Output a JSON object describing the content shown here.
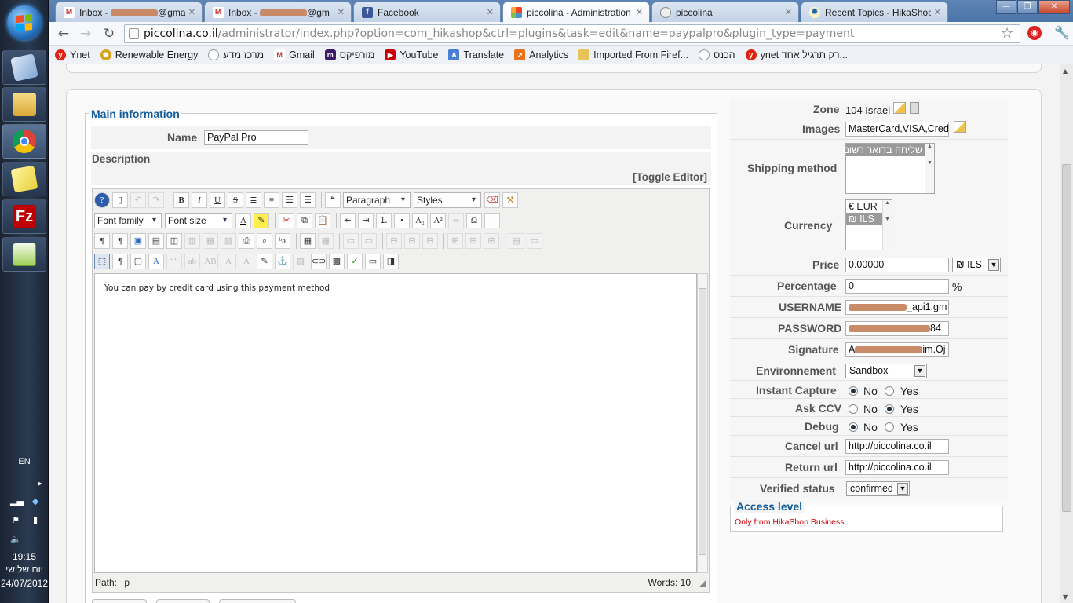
{
  "taskbar": {
    "lang": "EN",
    "time": "19:15",
    "day": "יום שלישי",
    "date": "24/07/2012"
  },
  "browser": {
    "tabs": [
      {
        "label": "Inbox - ",
        "suffix": "@gmai",
        "icon": "gmail-icon"
      },
      {
        "label": "Inbox - ",
        "suffix": "@gm",
        "icon": "gmail-icon"
      },
      {
        "label": "Facebook",
        "suffix": "",
        "icon": "facebook-icon"
      },
      {
        "label": "piccolina - Administration",
        "suffix": "",
        "icon": "joomla-icon"
      },
      {
        "label": "piccolina",
        "suffix": "",
        "icon": "globe-icon"
      },
      {
        "label": "Recent Topics - HikaShop",
        "suffix": "",
        "icon": "hikashop-icon"
      }
    ],
    "url_host": "piccolina.co.il",
    "url_path": "/administrator/index.php?option=com_hikashop&ctrl=plugins&task=edit&name=paypalpro&plugin_type=payment",
    "bookmarks": [
      "Ynet",
      "Renewable Energy",
      "מרכז מדע",
      "Gmail",
      "מורפיקס",
      "YouTube",
      "Translate",
      "Analytics",
      "Imported From Firef...",
      "הכנס",
      "ynet רק תרגיל אחד..."
    ]
  },
  "main": {
    "legend": "Main information",
    "name_label": "Name",
    "name_value": "PayPal Pro",
    "description_label": "Description",
    "toggle_editor": "[Toggle Editor]",
    "editor": {
      "format_select": "Paragraph",
      "styles_select": "Styles",
      "font_family": "Font family",
      "font_size": "Font size",
      "content": "You can pay by credit card using this payment method",
      "path_label": "Path:",
      "path_value": "p",
      "words": "Words: 10"
    }
  },
  "settings": {
    "zone_label": "Zone",
    "zone_value": "104 Israel",
    "images_label": "Images",
    "images_value": "MasterCard,VISA,Credit",
    "shipping_label": "Shipping method",
    "shipping_options": [
      "שליחה בדואר רשום"
    ],
    "currency_label": "Currency",
    "currency_options": [
      "€ EUR",
      "₪ ILS"
    ],
    "price_label": "Price",
    "price_value": "0.00000",
    "price_currency": "₪ ILS",
    "percentage_label": "Percentage",
    "percentage_value": "0",
    "percent_sign": "%",
    "username_label": "USERNAME",
    "username_tail": "_api1.gm",
    "password_label": "PASSWORD",
    "password_tail": "84",
    "signature_label": "Signature",
    "signature_head": "A",
    "signature_tail": "im.Oj",
    "environment_label": "Environnement",
    "environment_value": "Sandbox",
    "instant_capture_label": "Instant Capture",
    "ask_ccv_label": "Ask CCV",
    "debug_label": "Debug",
    "no": "No",
    "yes": "Yes",
    "cancel_url_label": "Cancel url",
    "cancel_url_value": "http://piccolina.co.il",
    "return_url_label": "Return url",
    "return_url_value": "http://piccolina.co.il",
    "verified_label": "Verified status",
    "verified_value": "confirmed",
    "access_level_label": "Access level",
    "access_level_note": "Only from HikaShop Business"
  }
}
